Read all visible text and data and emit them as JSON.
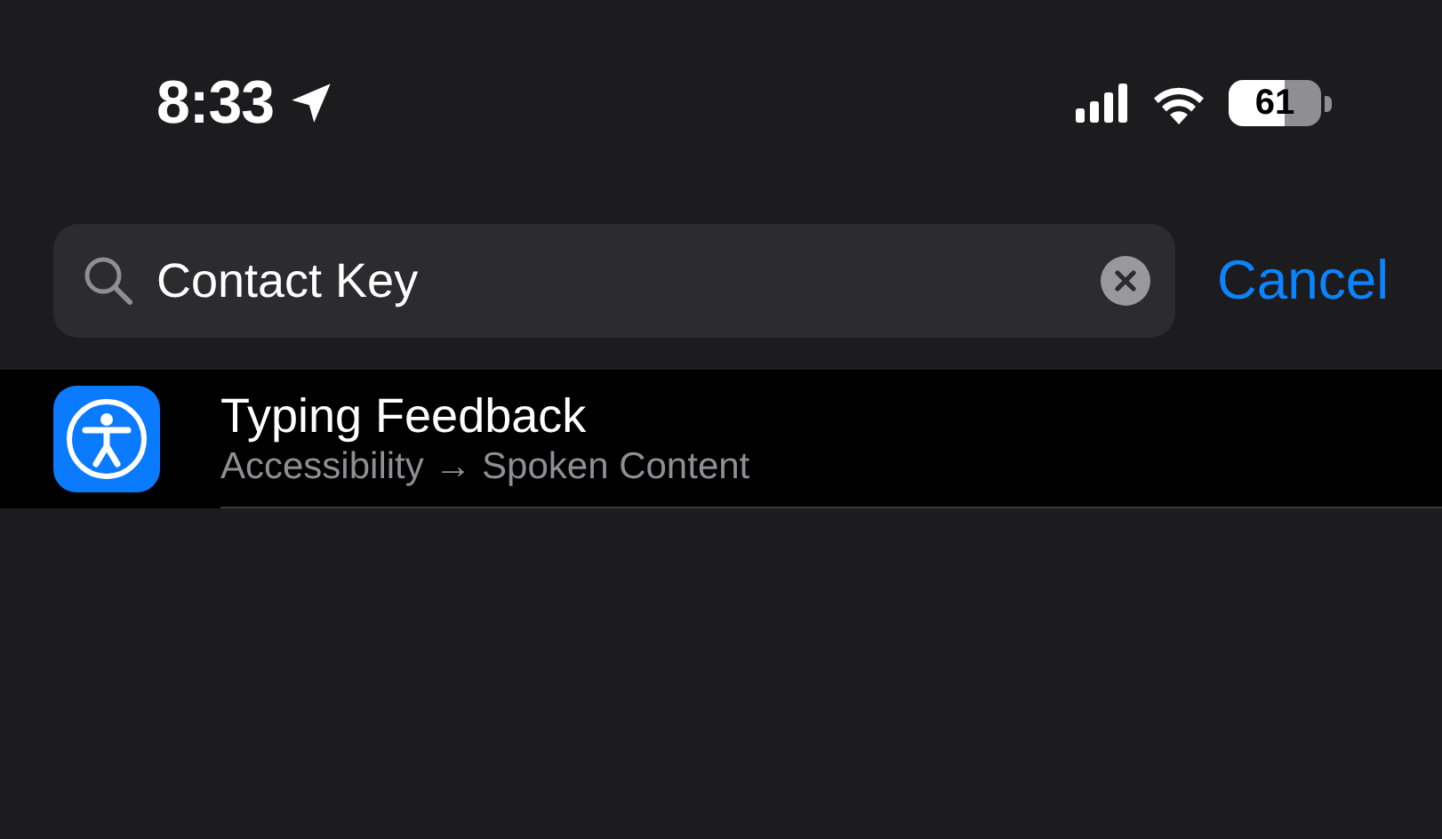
{
  "status_bar": {
    "time": "8:33",
    "battery": "61"
  },
  "search": {
    "value": "Contact Key"
  },
  "cancel_button": "Cancel",
  "results": [
    {
      "title": "Typing Feedback",
      "subtitle": "Accessibility → Spoken Content"
    }
  ]
}
